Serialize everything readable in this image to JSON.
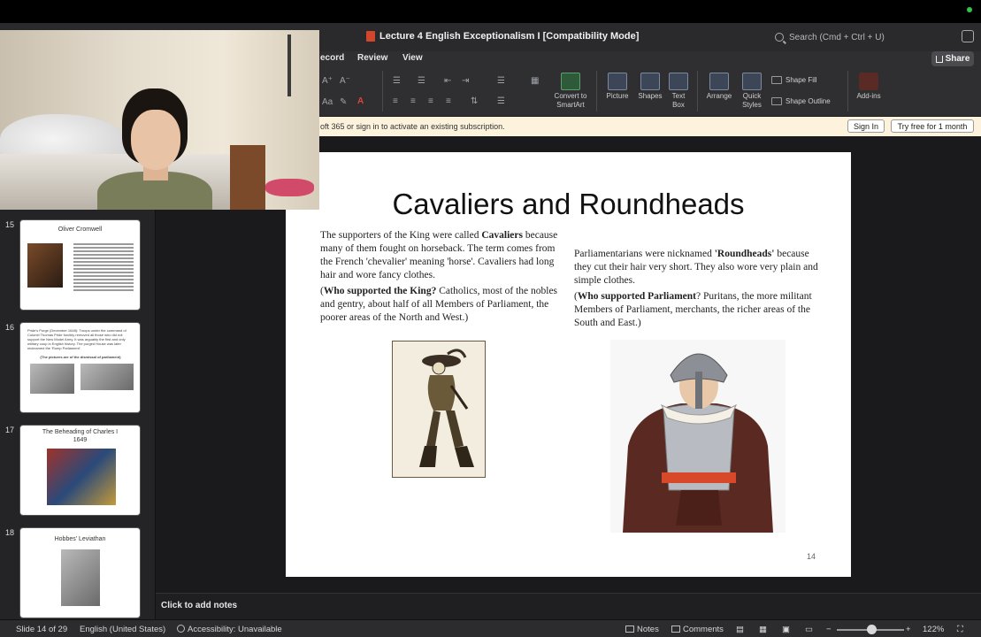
{
  "window": {
    "doc_title": "Lecture 4 English Exceptionalism I [Compatibility Mode]",
    "search_placeholder": "Search (Cmd + Ctrl + U)"
  },
  "ribbon": {
    "tabs": [
      "ecord",
      "Review",
      "View"
    ],
    "share_label": "Share",
    "buttons": {
      "convert": "Convert to SmartArt",
      "picture": "Picture",
      "shapes": "Shapes",
      "textbox": "Text Box",
      "arrange": "Arrange",
      "quick_styles": "Quick Styles",
      "shape_fill": "Shape Fill",
      "shape_outline": "Shape Outline",
      "addins": "Add-ins"
    }
  },
  "activation": {
    "message": "oft 365 or sign in to activate an existing subscription.",
    "signin": "Sign In",
    "tryfree": "Try free for 1 month"
  },
  "thumbnails": [
    {
      "num": "15",
      "title": "Oliver Cromwell"
    },
    {
      "num": "16",
      "title": "",
      "text": "Pride's Purge (December 1648): Troops under the command of Colonel Thomas Pride forcibly removed all those who did not support the New Model Army. It was arguably the first and only military coup in English history. The purged House was later nicknamed the 'Rump Parliament'.",
      "caption": "(The pictures are of the dismissal of parliament)"
    },
    {
      "num": "17",
      "title": "The Beheading of Charles I",
      "subtitle": "1649"
    },
    {
      "num": "18",
      "title": "Hobbes' Leviathan"
    }
  ],
  "slide": {
    "title": "Cavaliers and Roundheads",
    "left_p1_a": "The supporters of the King were called ",
    "left_p1_b": "Cavaliers",
    "left_p1_c": " because many of them fought on horseback. The term comes from the French 'chevalier' meaning 'horse'. Cavaliers had long hair and wore fancy clothes.",
    "left_p2_a": "(",
    "left_p2_b": "Who supported the King?",
    "left_p2_c": " Catholics, most of the nobles and gentry, about half of all Members of Parliament, the poorer areas of the North and West.)",
    "right_p1_a": "Parliamentarians were nicknamed ",
    "right_p1_b": "'Roundheads'",
    "right_p1_c": " because they cut their hair very short. They also wore very plain and simple clothes.",
    "right_p2_a": "(",
    "right_p2_b": "Who supported Parliament",
    "right_p2_c": "? Puritans, the more militant Members of Parliament, merchants, the richer areas of the South and East.)",
    "number": "14"
  },
  "notes_placeholder": "Click to add notes",
  "status": {
    "slide_info": "Slide 14 of 29",
    "language": "English (United States)",
    "accessibility": "Accessibility: Unavailable",
    "notes": "Notes",
    "comments": "Comments",
    "zoom": "122%"
  }
}
